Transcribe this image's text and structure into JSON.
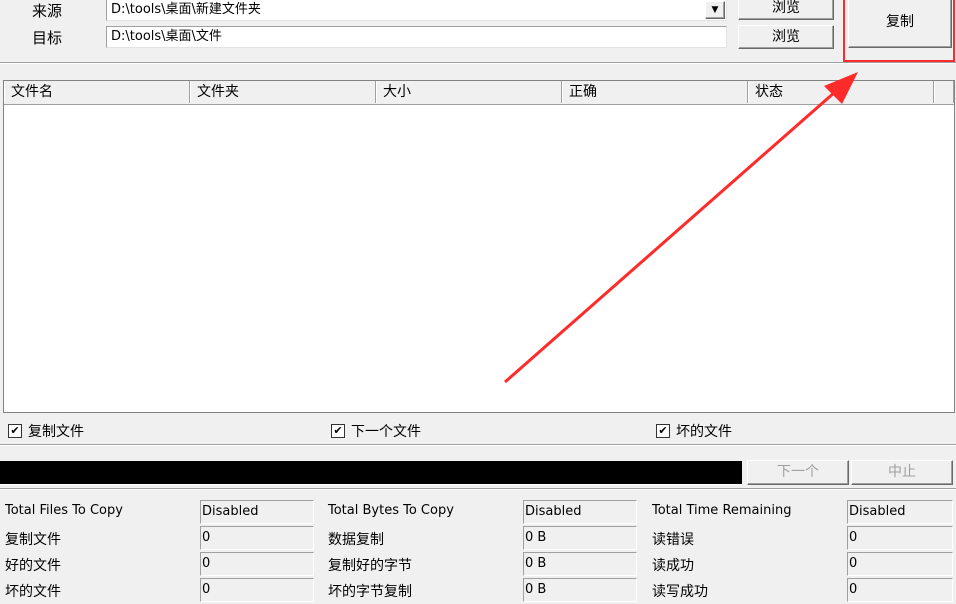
{
  "source": {
    "label": "来源",
    "value": "D:\\tools\\桌面\\新建文件夹"
  },
  "target": {
    "label": "目标",
    "value": "D:\\tools\\桌面\\文件"
  },
  "buttons": {
    "browse1": "浏览",
    "browse2": "浏览",
    "copy": "复制",
    "next": "下一个",
    "stop": "中止"
  },
  "list": {
    "columns": [
      "文件名",
      "文件夹",
      "大小",
      "正确",
      "状态"
    ]
  },
  "checkboxes": [
    {
      "label": "复制文件",
      "checked": true
    },
    {
      "label": "下一个文件",
      "checked": true
    },
    {
      "label": "坏的文件",
      "checked": true
    }
  ],
  "progress": 0,
  "stats": [
    [
      {
        "label": "Total Files To Copy",
        "value": "Disabled"
      },
      {
        "label": "Total Bytes To Copy",
        "value": "Disabled"
      },
      {
        "label": "Total Time Remaining",
        "value": "Disabled"
      }
    ],
    [
      {
        "label": "复制文件",
        "value": "0"
      },
      {
        "label": "数据复制",
        "value": "0 B"
      },
      {
        "label": "读错误",
        "value": "0"
      }
    ],
    [
      {
        "label": "好的文件",
        "value": "0"
      },
      {
        "label": "复制好的字节",
        "value": "0 B"
      },
      {
        "label": "读成功",
        "value": "0"
      }
    ],
    [
      {
        "label": "坏的文件",
        "value": "0"
      },
      {
        "label": "坏的字节复制",
        "value": "0 B"
      },
      {
        "label": "读写成功",
        "value": "0"
      }
    ]
  ],
  "colors": {
    "annotation": "#ff2a2a",
    "progress": "#000000"
  }
}
